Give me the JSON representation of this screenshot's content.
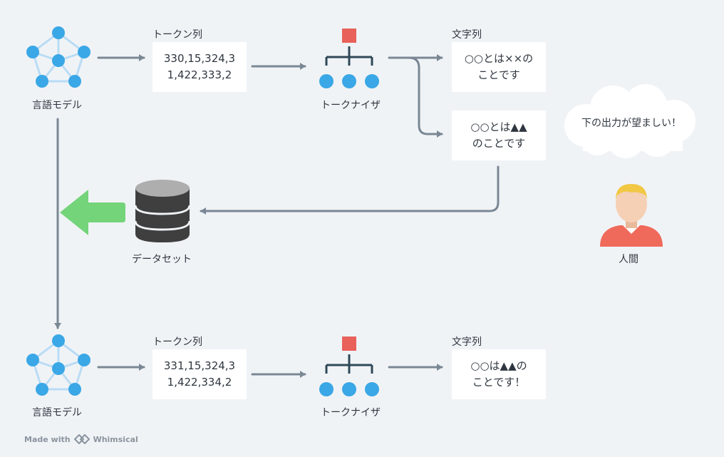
{
  "colors": {
    "background": "#f0f3f6",
    "arrow": "#7a8794",
    "node_blue": "#3aa7e6",
    "node_edge": "#b9dcf5",
    "tokenizer_red": "#e8615a",
    "tokenizer_line": "#2f4858",
    "green_arrow": "#74d47a",
    "database": "#3f3f3f",
    "person_hair": "#f1c744",
    "person_skin": "#f5d0b4",
    "person_shirt": "#ef6a5b"
  },
  "top_row": {
    "model_label": "言語モデル",
    "tokens_label": "トークン列",
    "tokens_value": "330,15,324,3\n1,422,333,2",
    "tokenizer_label": "トークナイザ",
    "strings_label": "文字列",
    "output1": "○○とは××の\nことです",
    "output2": "○○とは▲▲\nのことです"
  },
  "human": {
    "thought": "下の出力が望ましい！",
    "label": "人間",
    "icon": "person-icon"
  },
  "dataset": {
    "label": "データセット",
    "icon": "database-icon"
  },
  "bottom_row": {
    "model_label": "言語モデル",
    "tokens_label": "トークン列",
    "tokens_value": "331,15,324,3\n1,422,334,2",
    "tokenizer_label": "トークナイザ",
    "strings_label": "文字列",
    "output": "○○は▲▲の\nことです！"
  },
  "footer": {
    "made_with": "Made with",
    "brand": "Whimsical"
  }
}
